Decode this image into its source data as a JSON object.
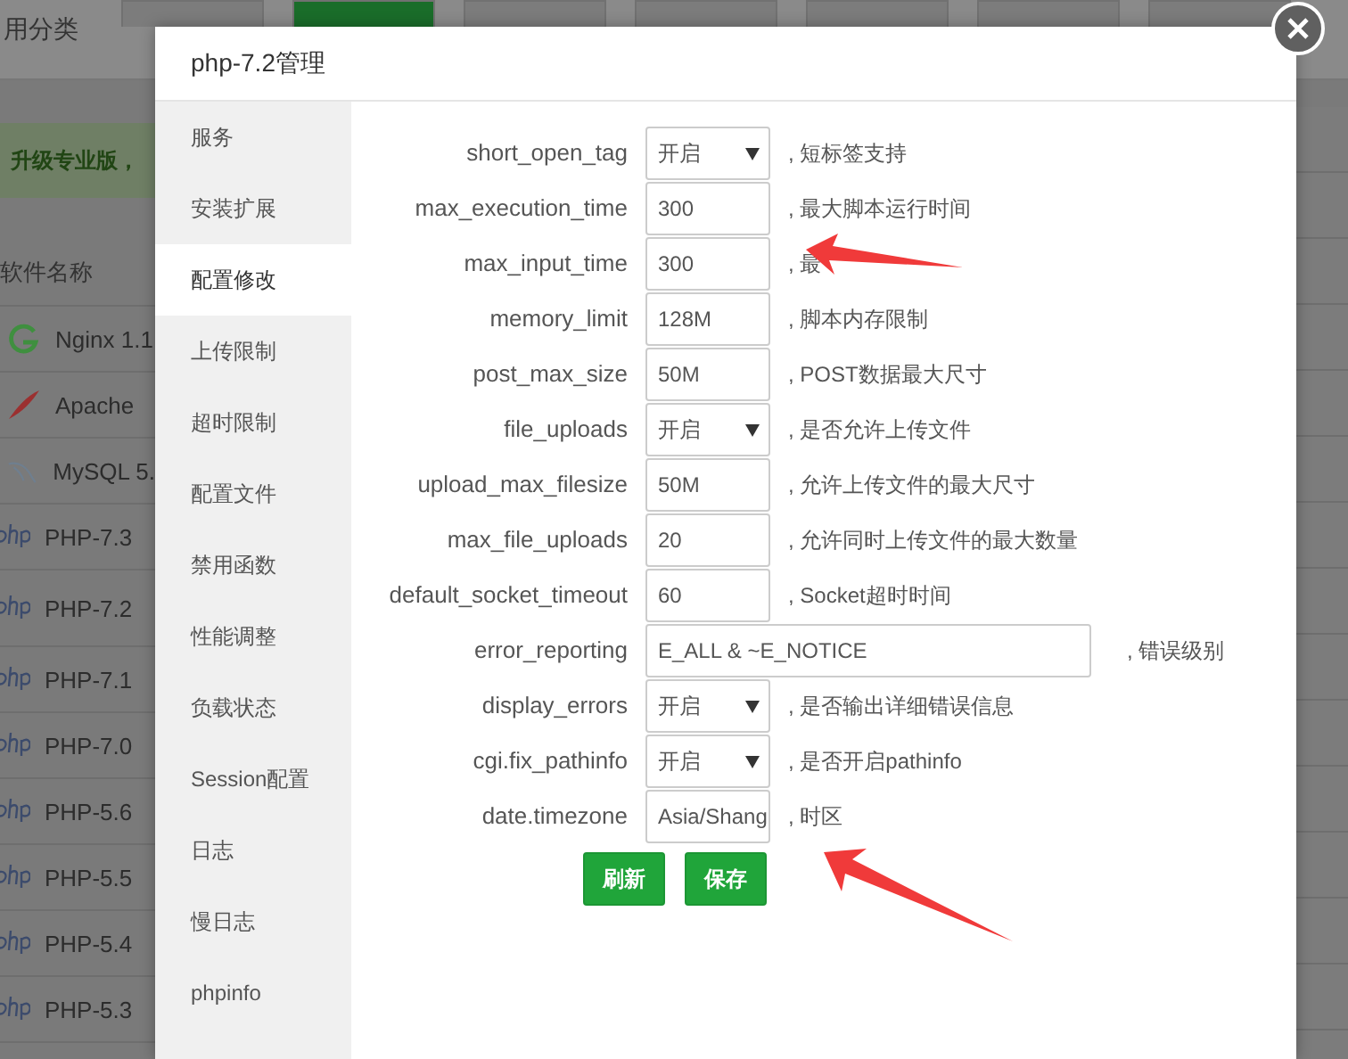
{
  "background": {
    "category_label": "用分类",
    "tabs": [
      {
        "selected": false
      },
      {
        "selected": true
      },
      {
        "selected": false
      },
      {
        "selected": false
      },
      {
        "selected": false
      },
      {
        "selected": false
      },
      {
        "selected": false
      }
    ],
    "banner": "升级专业版，",
    "list_header": "软件名称",
    "software": [
      {
        "kind": "nginx",
        "name": "Nginx 1.1"
      },
      {
        "kind": "apache",
        "name": "Apache"
      },
      {
        "kind": "mysql",
        "name": "MySQL 5."
      },
      {
        "kind": "php",
        "name": "PHP-7.3"
      },
      {
        "kind": "php",
        "name": "PHP-7.2"
      },
      {
        "kind": "php",
        "name": "PHP-7.1"
      },
      {
        "kind": "php",
        "name": "PHP-7.0"
      },
      {
        "kind": "php",
        "name": "PHP-5.6"
      },
      {
        "kind": "php",
        "name": "PHP-5.5"
      },
      {
        "kind": "php",
        "name": "PHP-5.4"
      },
      {
        "kind": "php",
        "name": "PHP-5.3"
      }
    ]
  },
  "dialog": {
    "title": "php-7.2管理",
    "menu": [
      {
        "label": "服务",
        "selected": false
      },
      {
        "label": "安装扩展",
        "selected": false
      },
      {
        "label": "配置修改",
        "selected": true
      },
      {
        "label": "上传限制",
        "selected": false
      },
      {
        "label": "超时限制",
        "selected": false
      },
      {
        "label": "配置文件",
        "selected": false
      },
      {
        "label": "禁用函数",
        "selected": false
      },
      {
        "label": "性能调整",
        "selected": false
      },
      {
        "label": "负载状态",
        "selected": false
      },
      {
        "label": "Session配置",
        "selected": false
      },
      {
        "label": "日志",
        "selected": false
      },
      {
        "label": "慢日志",
        "selected": false
      },
      {
        "label": "phpinfo",
        "selected": false
      }
    ],
    "settings": [
      {
        "name": "short_open_tag",
        "kind": "select",
        "value": "开启",
        "hint": ", 短标签支持"
      },
      {
        "name": "max_execution_time",
        "kind": "text",
        "value": "300",
        "hint": ", 最大脚本运行时间"
      },
      {
        "name": "max_input_time",
        "kind": "text",
        "value": "300",
        "hint": ", 最"
      },
      {
        "name": "memory_limit",
        "kind": "text",
        "value": "128M",
        "hint": ", 脚本内存限制"
      },
      {
        "name": "post_max_size",
        "kind": "text",
        "value": "50M",
        "hint": ", POST数据最大尺寸"
      },
      {
        "name": "file_uploads",
        "kind": "select",
        "value": "开启",
        "hint": ", 是否允许上传文件"
      },
      {
        "name": "upload_max_filesize",
        "kind": "text",
        "value": "50M",
        "hint": ", 允许上传文件的最大尺寸"
      },
      {
        "name": "max_file_uploads",
        "kind": "text",
        "value": "20",
        "hint": ", 允许同时上传文件的最大数量"
      },
      {
        "name": "default_socket_timeout",
        "kind": "text",
        "value": "60",
        "hint": ", Socket超时时间"
      },
      {
        "name": "error_reporting",
        "kind": "wide",
        "value": "E_ALL & ~E_NOTICE",
        "hint": ", 错误级别"
      },
      {
        "name": "display_errors",
        "kind": "select",
        "value": "开启",
        "hint": ", 是否输出详细错误信息"
      },
      {
        "name": "cgi.fix_pathinfo",
        "kind": "select",
        "value": "开启",
        "hint": ", 是否开启pathinfo"
      },
      {
        "name": "date.timezone",
        "kind": "text",
        "value": "Asia/Shang",
        "hint": ", 时区"
      }
    ],
    "buttons": [
      "刷新",
      "保存"
    ]
  }
}
